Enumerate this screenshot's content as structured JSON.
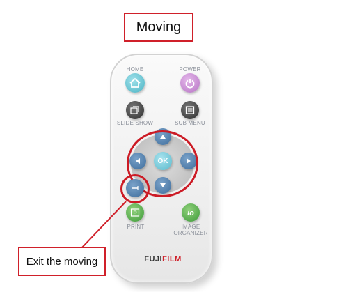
{
  "title": "Moving",
  "callout": "Exit the moving",
  "remote": {
    "home_label": "HOME",
    "power_label": "POWER",
    "slideshow_label": "SLIDE SHOW",
    "submenu_label": "SUB MENU",
    "ok_label": "OK",
    "print_label": "PRINT",
    "image_organizer_label_1": "IMAGE",
    "image_organizer_label_2": "ORGANIZER",
    "brand_1": "FUJI",
    "brand_2": "FILM"
  },
  "colors": {
    "highlight": "#d0202a",
    "home": "#4cb4c4",
    "power": "#b673c4",
    "arrow": "#3e6d9c",
    "green": "#3d9a39"
  },
  "icons": [
    "home-icon",
    "power-icon",
    "slideshow-icon",
    "submenu-icon",
    "arrow-up-icon",
    "arrow-down-icon",
    "arrow-left-icon",
    "arrow-right-icon",
    "back-icon",
    "print-icon",
    "image-organizer-icon"
  ]
}
